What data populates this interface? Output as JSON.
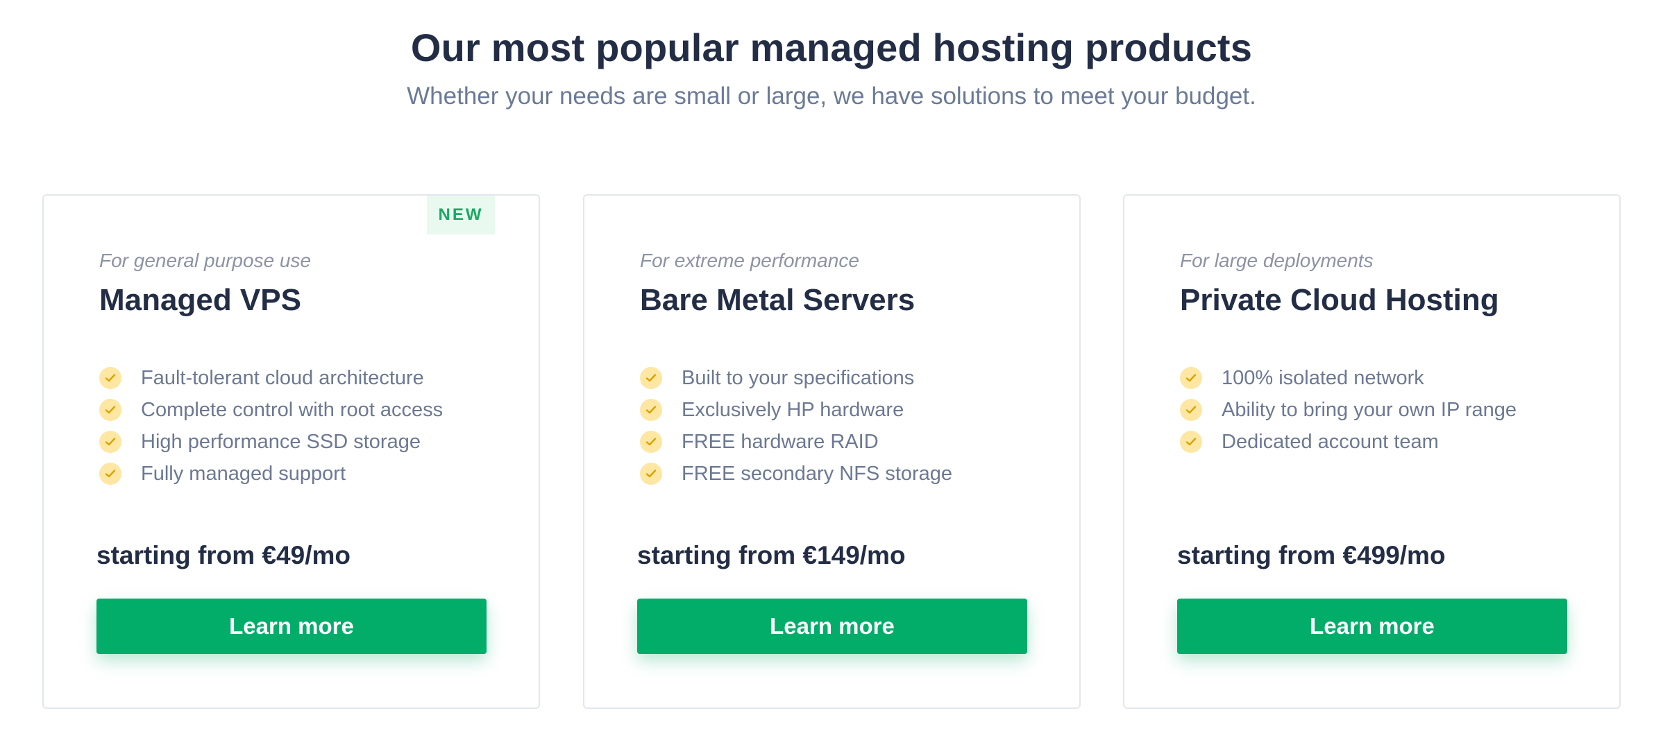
{
  "header": {
    "title": "Our most popular managed hosting products",
    "subtitle": "Whether your needs are small or large, we have solutions to meet your budget."
  },
  "colors": {
    "accent": "#02ad6a",
    "badge_text": "#1aa862",
    "badge_bg": "#e9f9f0",
    "check_bg": "#fde7a3",
    "check_mark": "#d9a300"
  },
  "cards": [
    {
      "badge": "NEW",
      "tagline": "For general purpose use",
      "name": "Managed VPS",
      "features": [
        "Fault-tolerant cloud architecture",
        "Complete control with root access",
        "High performance SSD storage",
        "Fully managed support"
      ],
      "price": "starting from €49/mo",
      "cta": "Learn more"
    },
    {
      "tagline": "For extreme performance",
      "name": "Bare Metal Servers",
      "features": [
        "Built to your specifications",
        "Exclusively HP hardware",
        "FREE hardware RAID",
        "FREE secondary NFS storage"
      ],
      "price": "starting from €149/mo",
      "cta": "Learn more"
    },
    {
      "tagline": "For large deployments",
      "name": "Private Cloud Hosting",
      "features": [
        "100% isolated network",
        "Ability to bring your own IP range",
        "Dedicated account team"
      ],
      "price": "starting from €499/mo",
      "cta": "Learn more"
    }
  ],
  "icons": {
    "feature_check": "check-icon"
  }
}
